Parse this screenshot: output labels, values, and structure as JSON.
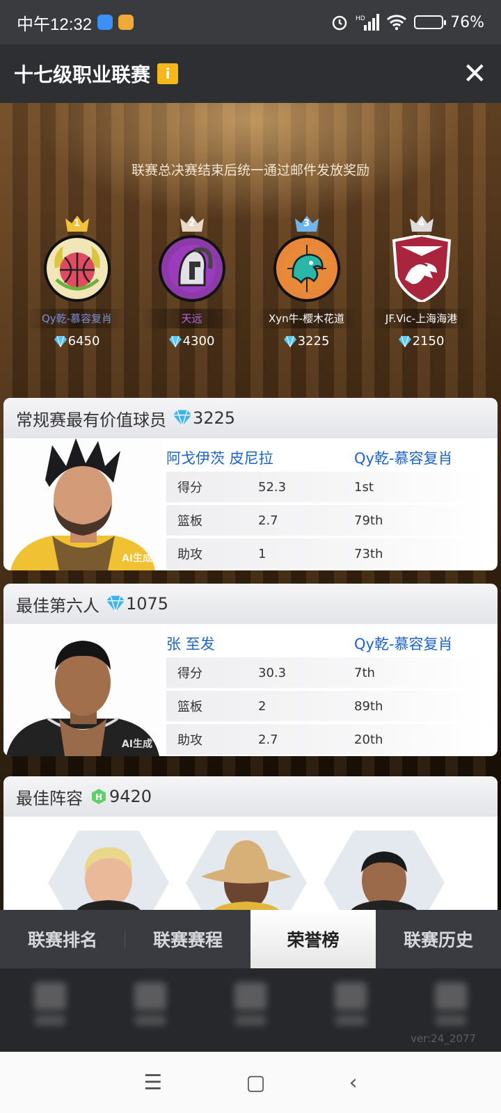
{
  "status": {
    "time": "中午12:32",
    "battery": "76%",
    "battery_level": 0.76
  },
  "header": {
    "title": "十七级职业联赛",
    "info_icon": "i"
  },
  "notice": "联赛总决赛结束后统一通过邮件发放奖励",
  "teams": [
    {
      "rank": "1",
      "name": "Qy乾-慕容复肖",
      "points": "6450",
      "name_color": "#7b8fd6",
      "crown_color": "#f3c23c"
    },
    {
      "rank": "2",
      "name": "天远",
      "points": "4300",
      "name_color": "#b46ad8",
      "crown_color": "#e8d8c4"
    },
    {
      "rank": "3",
      "name": "Xyn牛-樱木花道",
      "points": "3225",
      "name_color": "#ffffff",
      "crown_color": "#6fb6ef"
    },
    {
      "rank": "4",
      "name": "JF.Vic-上海海港",
      "points": "2150",
      "name_color": "#ffffff",
      "crown_color": "#dcdcdc"
    }
  ],
  "mvp": {
    "title": "常规赛最有价值球员",
    "points": "3225",
    "player": "阿戈伊茨 皮尼拉",
    "team": "Qy乾-慕容复肖",
    "ai_tag": "AI生成",
    "stats": [
      {
        "label": "得分",
        "value": "52.3",
        "rank": "1st"
      },
      {
        "label": "篮板",
        "value": "2.7",
        "rank": "79th"
      },
      {
        "label": "助攻",
        "value": "1",
        "rank": "73th"
      }
    ]
  },
  "sixth": {
    "title": "最佳第六人",
    "points": "1075",
    "player": "张 至发",
    "team": "Qy乾-慕容复肖",
    "ai_tag": "AI生成",
    "stats": [
      {
        "label": "得分",
        "value": "30.3",
        "rank": "7th"
      },
      {
        "label": "篮板",
        "value": "2",
        "rank": "89th"
      },
      {
        "label": "助攻",
        "value": "2.7",
        "rank": "20th"
      }
    ]
  },
  "lineup": {
    "title": "最佳阵容",
    "points": "9420"
  },
  "tabs": [
    {
      "label": "联赛排名"
    },
    {
      "label": "联赛赛程"
    },
    {
      "label": "荣誉榜"
    },
    {
      "label": "联赛历史"
    }
  ],
  "version": "ver:24_2077"
}
